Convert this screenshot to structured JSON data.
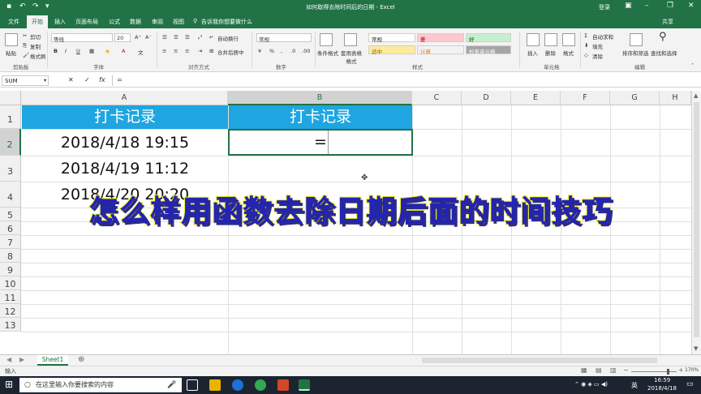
{
  "window": {
    "title": "如何取得去除时间后的日期 - Excel",
    "login": "登录",
    "share": "共享"
  },
  "tabs": [
    "文件",
    "开始",
    "插入",
    "页面布局",
    "公式",
    "数据",
    "审阅",
    "视图"
  ],
  "tellme": "告诉我你想要做什么",
  "ribbon": {
    "clipboard": {
      "paste": "粘贴",
      "cut": "剪切",
      "copy": "复制",
      "format_painter": "格式刷",
      "group": "剪贴板"
    },
    "font": {
      "name": "等线",
      "size": "20",
      "group": "字体",
      "bold": "B",
      "italic": "I",
      "underline": "U"
    },
    "alignment": {
      "wrap": "自动换行",
      "merge": "合并后居中",
      "group": "对齐方式"
    },
    "number": {
      "format": "常规",
      "group": "数字"
    },
    "styles": {
      "conditional": "条件格式",
      "table": "套用表格格式",
      "normal": "常规",
      "bad": "差",
      "good": "好",
      "neutral": "适中",
      "calc": "计算",
      "check": "检查单元格",
      "group": "样式"
    },
    "cells": {
      "insert": "插入",
      "delete": "删除",
      "format": "格式",
      "group": "单元格"
    },
    "editing": {
      "autosum": "自动求和",
      "fill": "填充",
      "clear": "清除",
      "sort": "排序和筛选",
      "find": "查找和选择",
      "group": "编辑"
    }
  },
  "formula_bar": {
    "name_box": "SUM",
    "cancel": "✕",
    "enter": "✓",
    "fx": "fx",
    "content": "="
  },
  "columns": [
    "A",
    "B",
    "C",
    "D",
    "E",
    "F",
    "G",
    "H"
  ],
  "rows": [
    "1",
    "2",
    "3",
    "4",
    "5",
    "6",
    "7",
    "8",
    "9",
    "10",
    "11",
    "12",
    "13"
  ],
  "cells": {
    "A1": "打卡记录",
    "B1": "打卡记录",
    "A2": "2018/4/18 19:15",
    "A3": "2018/4/19 11:12",
    "A4": "2018/4/20 20:20",
    "B2": "="
  },
  "banner": "怎么样用函数去除日期后面的时间技巧",
  "sheet_tab": "Sheet1",
  "status": {
    "mode": "输入",
    "zoom": "170%"
  },
  "taskbar": {
    "search_placeholder": "在这里输入你要搜索的内容",
    "time": "16:59",
    "date": "2018/4/18",
    "lang": "英"
  }
}
